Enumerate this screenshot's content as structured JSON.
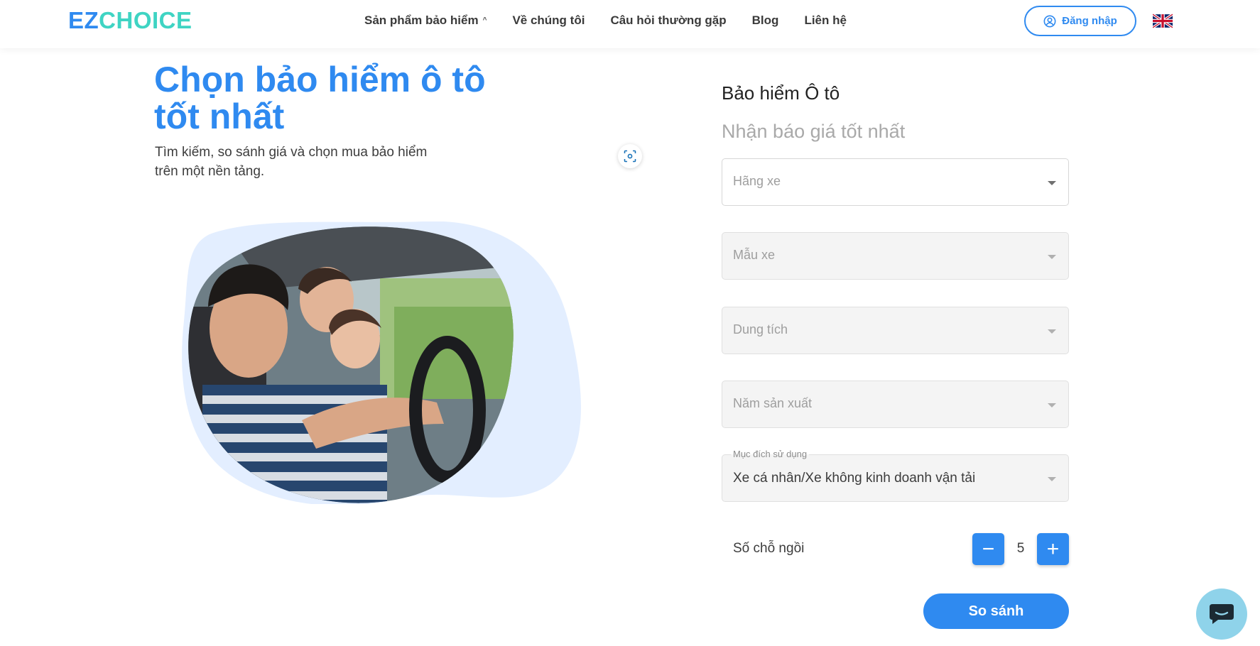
{
  "header": {
    "logo_ez": "EZ",
    "logo_choice": "CHOICE",
    "nav": [
      {
        "label": "Sản phẩm bảo hiểm",
        "has_caret": true
      },
      {
        "label": "Về chúng tôi"
      },
      {
        "label": "Câu hỏi thường gặp"
      },
      {
        "label": "Blog"
      },
      {
        "label": "Liên hệ"
      }
    ],
    "nav_caret": "^",
    "login_label": "Đăng nhập",
    "language_flag": "uk-flag-icon"
  },
  "hero": {
    "title": "Chọn bảo hiểm ô tô tốt nhất",
    "subtitle": "Tìm kiếm, so sánh giá và chọn mua bảo hiểm trên một nền tảng."
  },
  "form": {
    "title": "Bảo hiểm Ô tô",
    "subtitle": "Nhận báo giá tốt nhất",
    "brand_placeholder": "Hãng xe",
    "model_placeholder": "Mẫu xe",
    "engine_placeholder": "Dung tích",
    "year_placeholder": "Năm sản xuất",
    "purpose_label": "Mục đích sử dụng",
    "purpose_value": "Xe cá nhân/Xe không kinh doanh vận tải",
    "seats_label": "Số chỗ ngồi",
    "seats_value": "5",
    "minus_label": "−",
    "plus_label": "+",
    "submit_label": "So sánh"
  },
  "colors": {
    "primary": "#2f8af0",
    "logo_accent": "#3fd4c3",
    "chat_bubble": "#8fd3ea",
    "blob": "#e3eeff"
  }
}
